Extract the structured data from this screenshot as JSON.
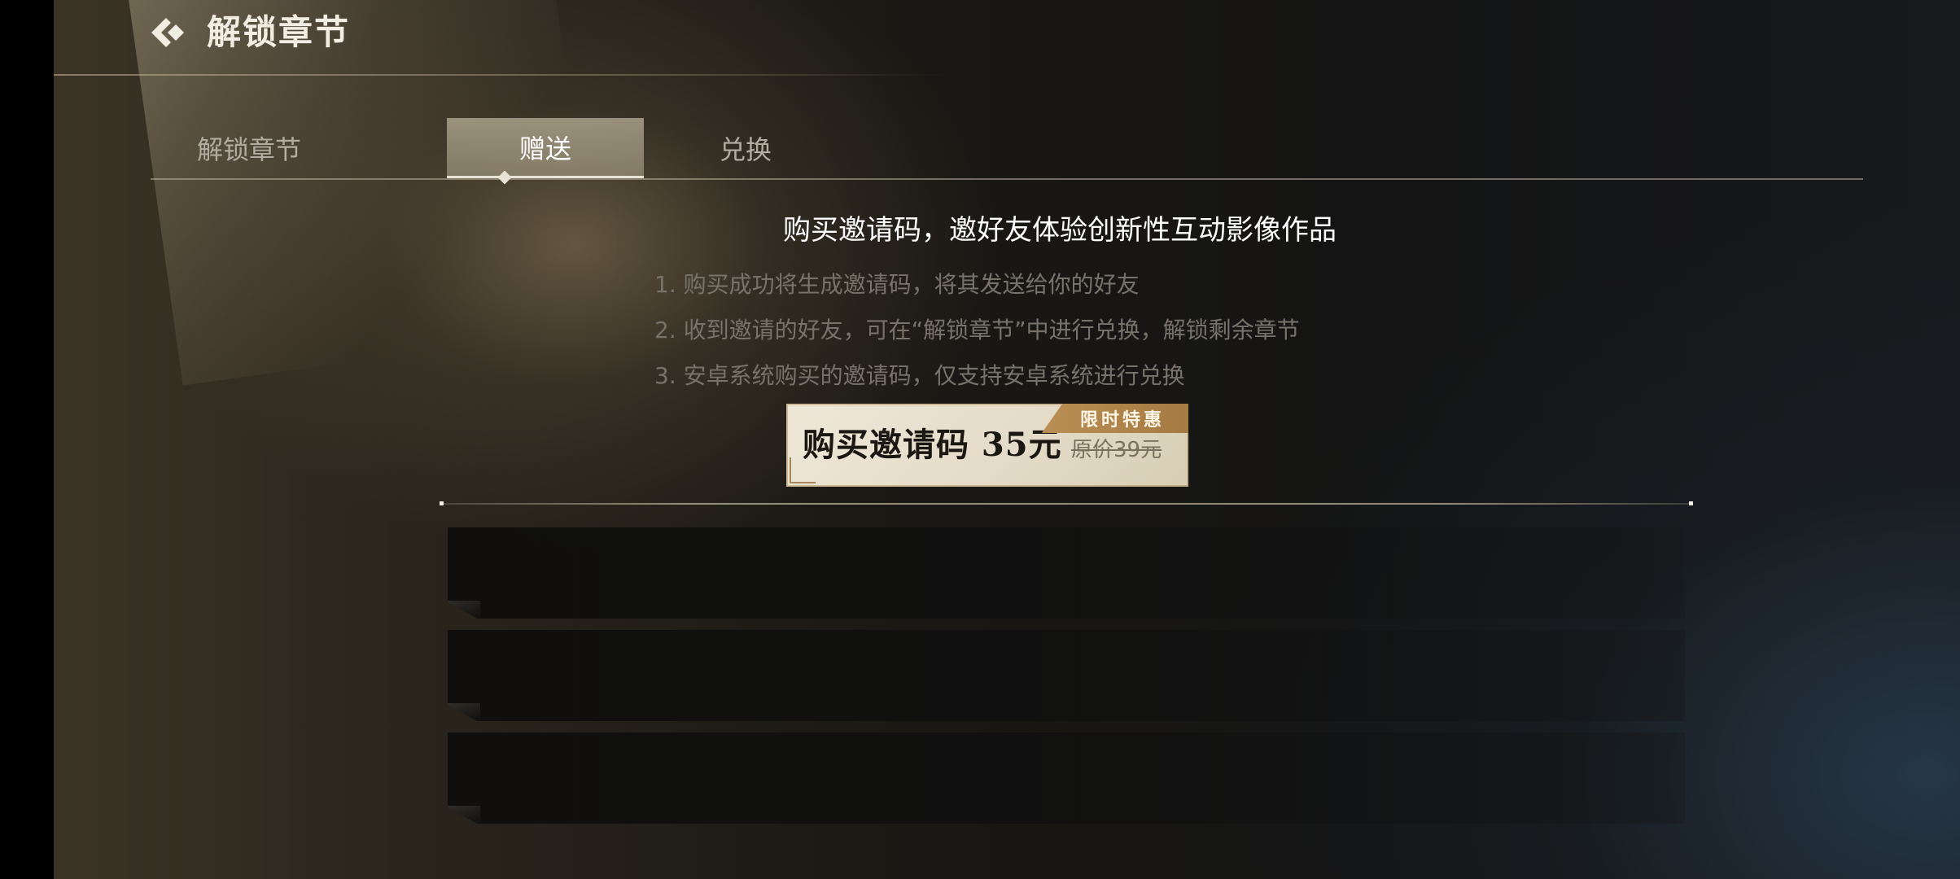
{
  "header": {
    "back_icon": "chevron-diamond-back-icon",
    "title": "解锁章节"
  },
  "tabs": [
    {
      "label": "解锁章节",
      "active": false
    },
    {
      "label": "赠送",
      "active": true
    },
    {
      "label": "兑换",
      "active": false
    }
  ],
  "gift": {
    "headline": "购买邀请码，邀好友体验创新性互动影像作品",
    "rules": [
      "1. 购买成功将生成邀请码，将其发送给你的好友",
      "2. 收到邀请的好友，可在“解锁章节”中进行兑换，解锁剩余章节",
      "3. 安卓系统购买的邀请码，仅支持安卓系统进行兑换"
    ],
    "buy_button": {
      "label": "购买邀请码 35元",
      "original_price": "原价39元",
      "badge": "限时特惠"
    }
  },
  "colors": {
    "accent_gold": "#a57b43",
    "button_bg": "#e4dcc8",
    "active_tab": "#c8bea4",
    "text_primary": "#ffffff",
    "text_muted": "#77726a"
  }
}
